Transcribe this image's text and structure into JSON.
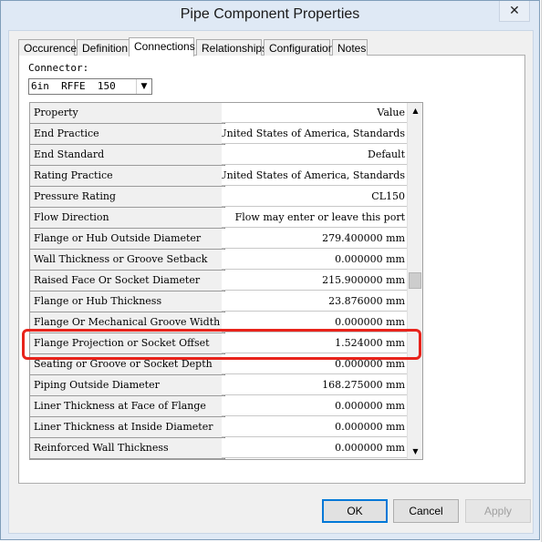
{
  "window": {
    "title": "Pipe Component Properties",
    "close_glyph": "✕"
  },
  "tabs": [
    {
      "label": "Occurence"
    },
    {
      "label": "Definition"
    },
    {
      "label": "Connections",
      "active": true
    },
    {
      "label": "Relationships"
    },
    {
      "label": "Configuration"
    },
    {
      "label": "Notes"
    }
  ],
  "connector": {
    "label": "Connector:",
    "selected": "6in  RFFE  150"
  },
  "grid": {
    "header": {
      "property": "Property",
      "value": "Value"
    },
    "rows": [
      {
        "property": "End Practice",
        "value": "United States of America, Standards"
      },
      {
        "property": "End Standard",
        "value": "Default"
      },
      {
        "property": "Rating Practice",
        "value": "United States of America, Standards"
      },
      {
        "property": "Pressure Rating",
        "value": "CL150"
      },
      {
        "property": "Flow Direction",
        "value": "Flow may enter or leave this port"
      },
      {
        "property": "Flange or Hub Outside Diameter",
        "value": "279.400000 mm"
      },
      {
        "property": "Wall Thickness or Groove Setback",
        "value": "0.000000 mm"
      },
      {
        "property": "Raised Face Or Socket Diameter",
        "value": "215.900000 mm"
      },
      {
        "property": "Flange or Hub Thickness",
        "value": "23.876000 mm"
      },
      {
        "property": "Flange Or Mechanical Groove Width",
        "value": "0.000000 mm"
      },
      {
        "property": "Flange Projection or Socket Offset",
        "value": "1.524000 mm"
      },
      {
        "property": "Seating or Groove or Socket Depth",
        "value": "0.000000 mm"
      },
      {
        "property": "Piping Outside Diameter",
        "value": "168.275000 mm"
      },
      {
        "property": "Liner Thickness at Face of Flange",
        "value": "0.000000 mm"
      },
      {
        "property": "Liner Thickness at Inside Diameter",
        "value": "0.000000 mm"
      },
      {
        "property": "Reinforced Wall Thickness",
        "value": "0.000000 mm"
      },
      {
        "property": "",
        "value": ""
      }
    ]
  },
  "buttons": {
    "ok": "OK",
    "cancel": "Cancel",
    "apply": "Apply"
  },
  "colors": {
    "highlight": "#e8231b",
    "dialog_frame": "#dfe9f5"
  }
}
